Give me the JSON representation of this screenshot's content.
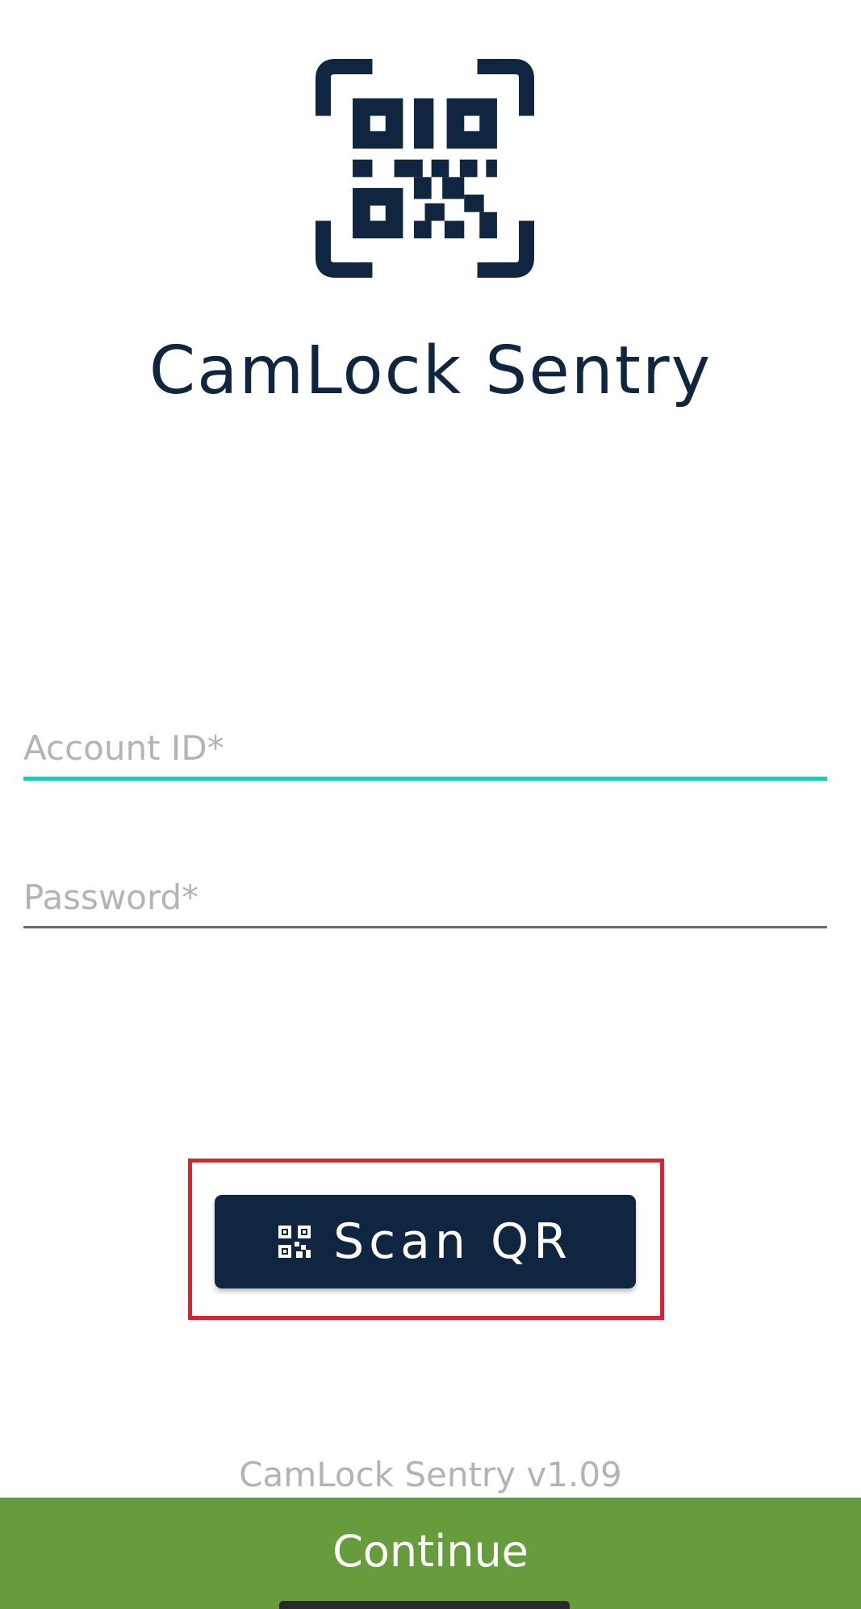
{
  "app": {
    "title": "CamLock Sentry",
    "logo_icon": "qr-code-scan-icon"
  },
  "form": {
    "account_id": {
      "value": "",
      "placeholder": "Account ID*"
    },
    "password": {
      "value": "",
      "placeholder": "Password*"
    }
  },
  "actions": {
    "scan_qr_label": "Scan QR",
    "scan_qr_icon": "qr-code-icon",
    "continue_label": "Continue"
  },
  "footer": {
    "version_text": "CamLock Sentry v1.09"
  },
  "colors": {
    "primary_navy": "#0f2540",
    "accent_teal": "#26c6b9",
    "continue_green": "#669c3b",
    "highlight_red": "#e0202e",
    "placeholder_gray": "#b3b3b3"
  }
}
